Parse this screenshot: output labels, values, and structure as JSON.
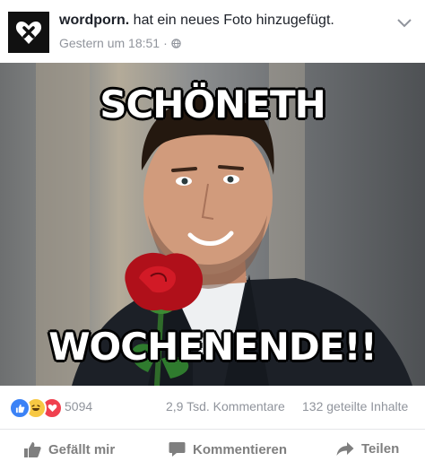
{
  "post": {
    "page_name": "wordporn.",
    "action_text": " hat ein neues Foto hinzugefügt.",
    "timestamp": "Gestern um 18:51",
    "separator": "·"
  },
  "photo": {
    "caption_top": "SCHÖNETH",
    "caption_bottom": "WOCHENENDE!!"
  },
  "stats": {
    "reaction_count": "5094",
    "comments": "2,9 Tsd. Kommentare",
    "shares": "132 geteilte Inhalte"
  },
  "actions": {
    "like": "Gefällt mir",
    "comment": "Kommentieren",
    "share": "Teilen"
  },
  "icons": [
    "heart-x-logo-icon",
    "globe-icon",
    "chevron-down-icon",
    "like-reaction-icon",
    "haha-reaction-icon",
    "love-reaction-icon",
    "thumbs-up-icon",
    "comment-icon",
    "share-arrow-icon"
  ],
  "colors": {
    "like_blue": "#3b82f6",
    "haha_yellow": "#f7c843",
    "love_red": "#f0404f",
    "meta_gray": "#90949c"
  }
}
